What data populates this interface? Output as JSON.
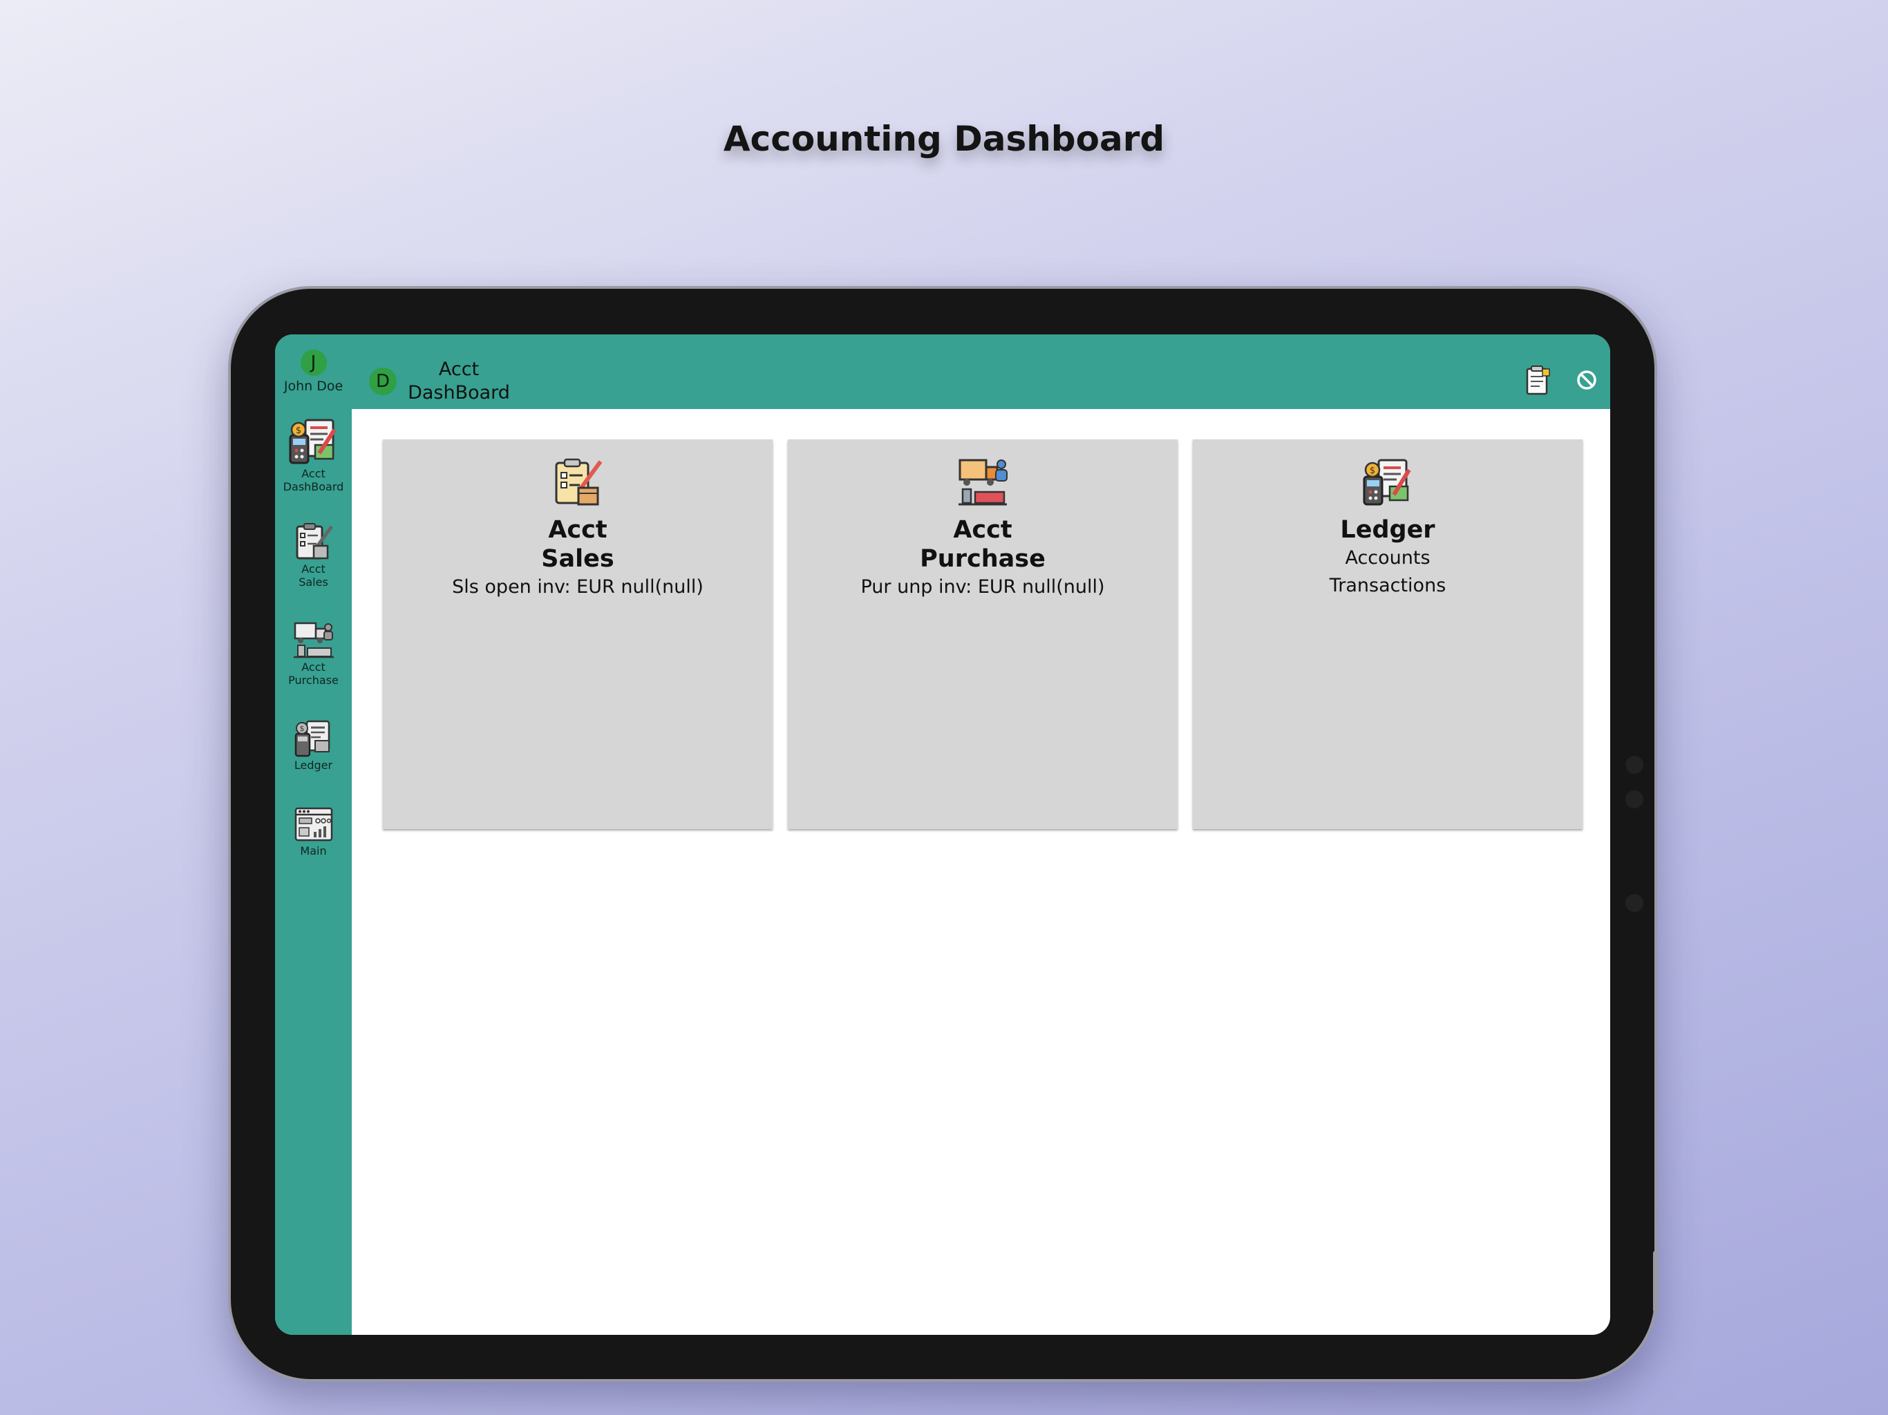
{
  "promo": {
    "title": "Accounting Dashboard"
  },
  "user": {
    "initial": "J",
    "name": "John Doe"
  },
  "sidebar": {
    "items": [
      {
        "label": "Acct\nDashBoard",
        "icon": "ledger-calculator-icon"
      },
      {
        "label": "Acct\nSales",
        "icon": "sales-clipboard-icon"
      },
      {
        "label": "Acct\nPurchase",
        "icon": "purchase-truck-icon"
      },
      {
        "label": "Ledger",
        "icon": "ledger-calculator-icon"
      },
      {
        "label": "Main",
        "icon": "dashboard-grid-icon"
      }
    ]
  },
  "header": {
    "badge": "D",
    "title": "Acct\nDashBoard",
    "icons": [
      "notes-icon",
      "block-icon"
    ]
  },
  "cards": [
    {
      "title": "Acct\nSales",
      "lines": [
        "Sls open inv: EUR null(null)"
      ],
      "icon": "sales-clipboard-icon"
    },
    {
      "title": "Acct\nPurchase",
      "lines": [
        "Pur unp inv: EUR null(null)"
      ],
      "icon": "purchase-truck-icon"
    },
    {
      "title": "Ledger",
      "lines": [
        "Accounts",
        "Transactions"
      ],
      "icon": "ledger-calculator-icon"
    }
  ],
  "colors": {
    "brand": "#38a191",
    "badge": "#2fa044",
    "card": "#d6d6d6"
  }
}
